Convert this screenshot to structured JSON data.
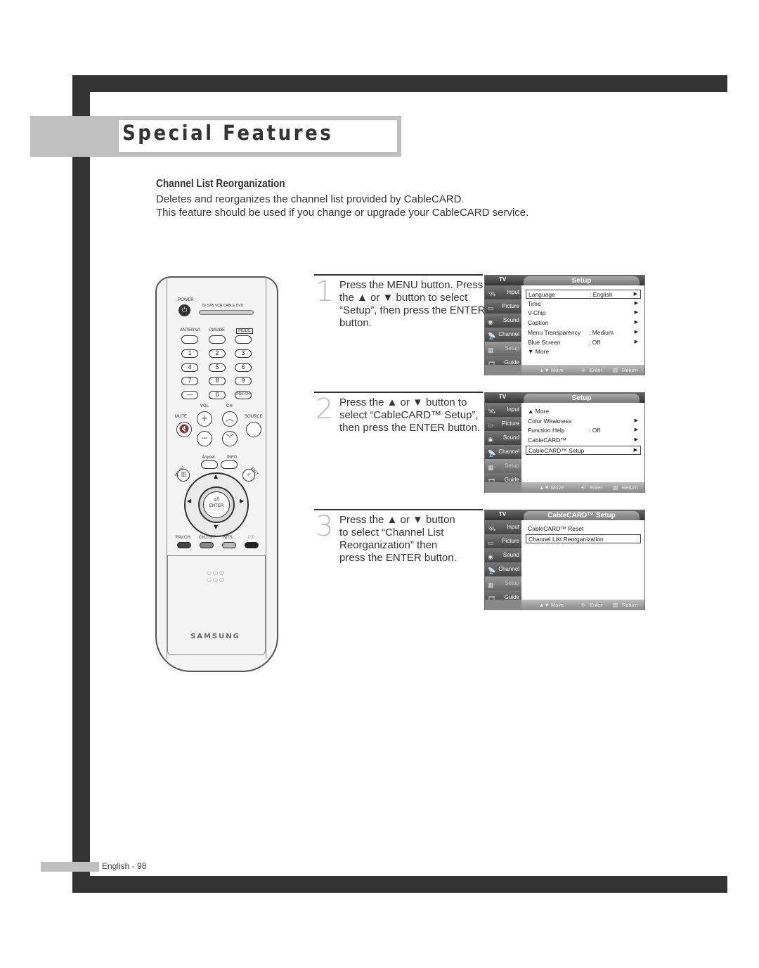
{
  "page": {
    "section_title": "Special Features",
    "heading": "Channel List Reorganization",
    "description": [
      "Deletes and reorganizes the channel list provided by CableCARD.",
      "This feature should be used if you change or upgrade your CableCARD service."
    ],
    "footer": "English - 98"
  },
  "remote": {
    "power_label": "POWER",
    "modes": "TV  STB  VCR  CABLE  DVD",
    "antenna": "ANTENNA",
    "pmode": "P.MODE",
    "mode": "MODE",
    "keys": [
      "1",
      "2",
      "3",
      "4",
      "5",
      "6",
      "7",
      "8",
      "9",
      "—",
      "0",
      "PRE-CH"
    ],
    "vol": "VOL",
    "ch": "CH",
    "mute": "MUTE",
    "source": "SOURCE",
    "anynet": "Anynet",
    "info": "INFO",
    "menu": "MENU",
    "exit": "EXIT",
    "enter": "ENTER",
    "favch": "FAV.CH",
    "chlist": "CH.LIST",
    "mts": "MTS",
    "pip": "PIP",
    "brand": "SAMSUNG",
    "color_buttons": [
      "#444444",
      "#888888",
      "#bbbbbb",
      "#222222"
    ]
  },
  "steps": [
    {
      "number": "1",
      "text": "Press the MENU button. Press the ▲ or ▼ button to select “Setup”, then press the ENTER button."
    },
    {
      "number": "2",
      "text": "Press the ▲ or ▼ button to select “CableCARD™ Setup”, then press the ENTER button."
    },
    {
      "number": "3",
      "text": "Press the ▲ or ▼ button to select “Channel List Reorganization” then press the ENTER button."
    }
  ],
  "osd_common": {
    "tv": "TV",
    "sidebar": [
      {
        "label": "Input",
        "icon": "input-icon"
      },
      {
        "label": "Picture",
        "icon": "picture-icon"
      },
      {
        "label": "Sound",
        "icon": "sound-icon"
      },
      {
        "label": "Channel",
        "icon": "channel-icon"
      },
      {
        "label": "Setup",
        "icon": "setup-icon"
      },
      {
        "label": "Guide",
        "icon": "guide-icon"
      }
    ],
    "footer": {
      "move": "▲▼ Move",
      "enter": "Enter",
      "return": "Return"
    }
  },
  "osd_screens": [
    {
      "title": "Setup",
      "rows": [
        {
          "label": "Language",
          "value": ": English",
          "arrow": true,
          "selected": true
        },
        {
          "label": "Time",
          "value": "",
          "arrow": true,
          "selected": false
        },
        {
          "label": "V-Chip",
          "value": "",
          "arrow": true,
          "selected": false
        },
        {
          "label": "Caption",
          "value": "",
          "arrow": true,
          "selected": false
        },
        {
          "label": "Menu Transparency",
          "value": ": Medium",
          "arrow": true,
          "selected": false
        },
        {
          "label": "Blue Screen",
          "value": ": Off",
          "arrow": true,
          "selected": false
        },
        {
          "label": "▼ More",
          "value": "",
          "arrow": false,
          "selected": false
        }
      ]
    },
    {
      "title": "Setup",
      "rows": [
        {
          "label": "▲ More",
          "value": "",
          "arrow": false,
          "selected": false
        },
        {
          "label": "Color Weakness",
          "value": "",
          "arrow": true,
          "selected": false
        },
        {
          "label": "Function Help",
          "value": ": Off",
          "arrow": true,
          "selected": false
        },
        {
          "label": "CableCARD™",
          "value": "",
          "arrow": true,
          "selected": false
        },
        {
          "label": "CableCARD™ Setup",
          "value": "",
          "arrow": true,
          "selected": true
        }
      ]
    },
    {
      "title": "CableCARD™ Setup",
      "rows": [
        {
          "label": "CableCARD™ Reset",
          "value": "",
          "arrow": false,
          "selected": false
        },
        {
          "label": "Channel List Reorganization",
          "value": "",
          "arrow": false,
          "selected": true
        }
      ]
    }
  ]
}
